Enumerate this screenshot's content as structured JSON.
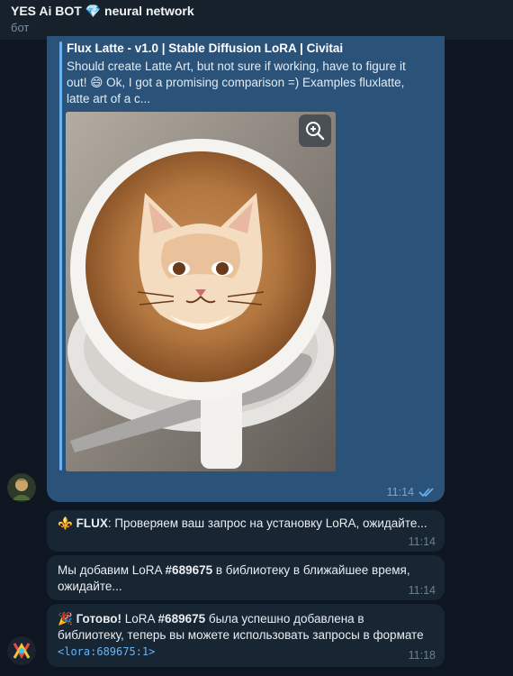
{
  "header": {
    "title_name": "YES Ai BOT",
    "title_gem": "💎",
    "title_suffix": "neural network",
    "subtitle": "бот"
  },
  "link_preview": {
    "title": "Flux Latte - v1.0 | Stable Diffusion LoRA | Civitai",
    "description_1": "Should create Latte Art, but not sure if working, have to figure it",
    "description_2": "out! 😄 Ok, I got a promising comparison =) Examples fluxlatte,",
    "description_3": "latte art of a c...",
    "image_icon": "latte-art-cat-image",
    "zoom_icon": "zoom-in-icon",
    "time": "11:14",
    "status_icon": "double-check-icon"
  },
  "messages": [
    {
      "emoji": "⚜️",
      "sender": "FLUX",
      "text": ": Проверяем ваш запрос на установку LoRA, ожидайте...",
      "time": "11:14"
    },
    {
      "line1_prefix": "Мы добавим LoRA ",
      "line1_id": "#689675",
      "line1_suffix": " в библиотеку в ближайшее время,",
      "line2": "ожидайте...",
      "time": "11:14"
    },
    {
      "emoji": "🎉",
      "label": "Готово!",
      "line1_prefix": " LoRA ",
      "line1_id": "#689675",
      "line1_suffix": " была успешно добавлена в",
      "line2": "библиотеку, теперь вы можете использовать запросы в формате",
      "code": "<lora:689675:1>",
      "time": "11:18"
    }
  ],
  "colors": {
    "background": "#0e1621",
    "outgoing_bubble": "#2b5278",
    "incoming_bubble": "#182533",
    "link_accent": "#6ab3f3"
  }
}
